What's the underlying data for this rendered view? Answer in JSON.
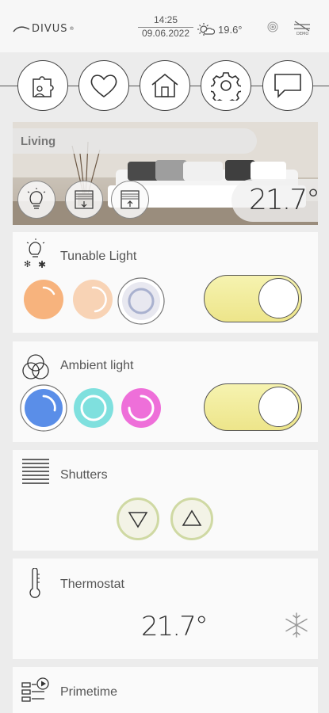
{
  "header": {
    "brand": "DIVUS",
    "time": "14:25",
    "date": "09.06.2022",
    "temperature": "19.6°"
  },
  "nav": {
    "items": [
      {
        "name": "puzzle-icon"
      },
      {
        "name": "heart-icon"
      },
      {
        "name": "home-icon"
      },
      {
        "name": "gear-icon"
      },
      {
        "name": "chat-icon"
      }
    ]
  },
  "room": {
    "label": "Living",
    "temperature": "21.7°"
  },
  "cards": {
    "tunable_light": {
      "title": "Tunable Light",
      "colors": [
        "#f7b37d",
        "#f8d3b5",
        "#e8e8f0"
      ],
      "toggle_on": true
    },
    "ambient_light": {
      "title": "Ambient light",
      "colors": [
        "#5a8ee8",
        "#7fe0de",
        "#ee6fd9"
      ],
      "toggle_on": true
    },
    "shutters": {
      "title": "Shutters"
    },
    "thermostat": {
      "title": "Thermostat",
      "value": "21.7°"
    },
    "primetime": {
      "title": "Primetime"
    }
  },
  "colors": {
    "toggle_accent": "#ede58a",
    "shutter_ring": "#cfd9a3"
  }
}
